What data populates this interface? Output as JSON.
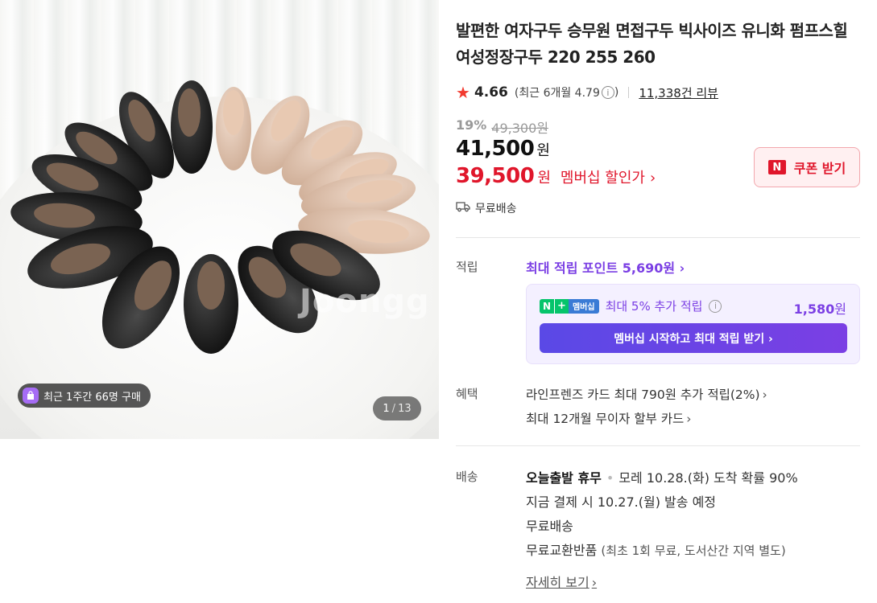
{
  "gallery": {
    "watermark": "Joongg",
    "bought_badge": "최근 1주간 66명 구매",
    "page_current": "1",
    "page_sep": "/",
    "page_total": "13"
  },
  "product": {
    "title": "발편한 여자구두 승무원 면접구두 빅사이즈 유니화 펌프스힐 여성정장구두 220 255 260",
    "rating": "4.66",
    "recent_rating": "(최근 6개월 4.79",
    "recent_rating_close": ")",
    "review_count": "11,338건 리뷰",
    "discount_rate": "19%",
    "original_price": "49,300원",
    "sale_price": "41,500",
    "currency": "원",
    "member_price": "39,500",
    "member_price_label": "멤버십 할인가",
    "free_shipping": "무료배송",
    "coupon_label": "쿠폰 받기",
    "coupon_n": "N"
  },
  "points": {
    "label": "적립",
    "max_points": "최대 적립 포인트 5,690원",
    "membership_logo_n": "N",
    "membership_logo_plus": "+",
    "membership_logo_text": "멤버십",
    "membership_extra": "최대 5% 추가 적립",
    "membership_amount": "1,580",
    "membership_amount_unit": "원",
    "cta": "멤버십 시작하고 최대 적립 받기 ›"
  },
  "benefits": {
    "label": "혜택",
    "items": [
      "라인프렌즈 카드 최대 790원 추가 적립(2%)",
      "최대 12개월 무이자 할부 카드"
    ]
  },
  "delivery": {
    "label": "배송",
    "today": "오늘출발 휴무",
    "arrival": "모레 10.28.(화) 도착 확률 90%",
    "dispatch": "지금 결제 시 10.27.(월) 발송 예정",
    "free": "무료배송",
    "exchange": "무료교환반품",
    "exchange_note": "(최초 1회 무료, 도서산간 지역 별도)",
    "detail_link": "자세히 보기"
  },
  "icons": {
    "rating": "star-icon",
    "truck": "truck-icon",
    "info": "info-icon",
    "chevron": "chevron-right-icon",
    "bag": "shopping-bag-icon"
  },
  "colors": {
    "accent_red": "#e0162b",
    "star_red": "#f23a2f",
    "membership_purple": "#7b3fe4"
  }
}
